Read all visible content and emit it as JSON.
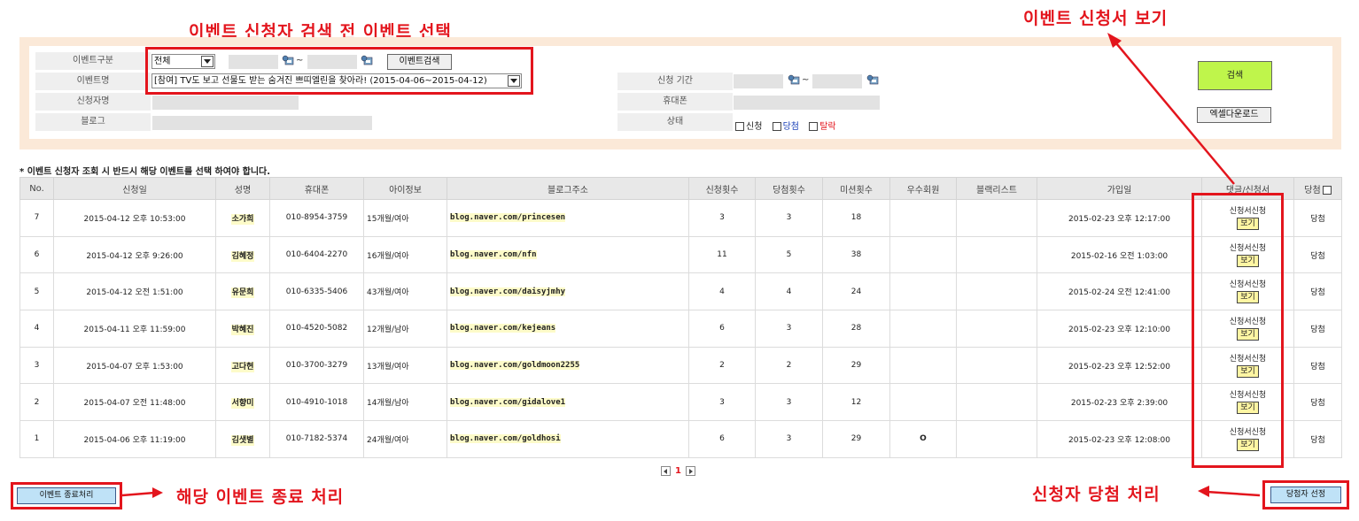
{
  "annotations": {
    "select_event": "이벤트 신청자 검색 전 이벤트 선택",
    "view_application": "이벤트 신청서 보기",
    "end_event": "해당 이벤트 종료 처리",
    "winner_process": "신청자 당첨 처리"
  },
  "search": {
    "event_type_label": "이벤트구분",
    "event_type_value": "전체",
    "event_search_button": "이벤트검색",
    "event_name_label": "이벤트명",
    "event_name_value": "[참여] TV도 보고 선물도 받는 숨겨진 쁘띠엘린을 찾아라! (2015-04-06~2015-04-12)",
    "applicant_label": "신청자명",
    "blog_label": "블로그",
    "period_label": "신청 기간",
    "phone_label": "휴대폰",
    "status_label": "상태",
    "status_options": [
      "신청",
      "당첨",
      "탈락"
    ],
    "tilde": "~",
    "search_button": "검색",
    "excel_button": "엑셀다운로드"
  },
  "notice": "* 이벤트 신청자 조회 시 반드시 해당 이벤트를 선택 하여야 합니다.",
  "table": {
    "headers": [
      "No.",
      "신청일",
      "성명",
      "휴대폰",
      "아이정보",
      "블로그주소",
      "신청횟수",
      "당첨횟수",
      "미션횟수",
      "우수회원",
      "블랙리스트",
      "가입일",
      "댓글/신청서",
      "당첨"
    ],
    "apply_label": "신청서신청",
    "view_label": "보기",
    "rows": [
      {
        "no": "7",
        "date": "2015-04-12 오후 10:53:00",
        "name": "소가희",
        "phone": "010-8954-3759",
        "child": "15개월/여아",
        "blog": "blog.naver.com/princesen",
        "apply": "3",
        "win": "3",
        "mission": "18",
        "vip": "",
        "black": "",
        "join": "2015-02-23 오후 12:17:00",
        "result": "당첨"
      },
      {
        "no": "6",
        "date": "2015-04-12 오후 9:26:00",
        "name": "김혜정",
        "phone": "010-6404-2270",
        "child": "16개월/여아",
        "blog": "blog.naver.com/nfn",
        "apply": "11",
        "win": "5",
        "mission": "38",
        "vip": "",
        "black": "",
        "join": "2015-02-16 오전 1:03:00",
        "result": "당첨"
      },
      {
        "no": "5",
        "date": "2015-04-12 오전 1:51:00",
        "name": "유문희",
        "phone": "010-6335-5406",
        "child": "43개월/여아",
        "blog": "blog.naver.com/daisyjmhy",
        "apply": "4",
        "win": "4",
        "mission": "24",
        "vip": "",
        "black": "",
        "join": "2015-02-24 오전 12:41:00",
        "result": "당첨"
      },
      {
        "no": "4",
        "date": "2015-04-11 오후 11:59:00",
        "name": "박혜진",
        "phone": "010-4520-5082",
        "child": "12개월/남아",
        "blog": "blog.naver.com/kejeans",
        "apply": "6",
        "win": "3",
        "mission": "28",
        "vip": "",
        "black": "",
        "join": "2015-02-23 오후 12:10:00",
        "result": "당첨"
      },
      {
        "no": "3",
        "date": "2015-04-07 오후 1:53:00",
        "name": "고다현",
        "phone": "010-3700-3279",
        "child": "13개월/여아",
        "blog": "blog.naver.com/goldmoon2255",
        "apply": "2",
        "win": "2",
        "mission": "29",
        "vip": "",
        "black": "",
        "join": "2015-02-23 오후 12:52:00",
        "result": "당첨"
      },
      {
        "no": "2",
        "date": "2015-04-07 오전 11:48:00",
        "name": "서향미",
        "phone": "010-4910-1018",
        "child": "14개월/남아",
        "blog": "blog.naver.com/gidalove1",
        "apply": "3",
        "win": "3",
        "mission": "12",
        "vip": "",
        "black": "",
        "join": "2015-02-23 오후 2:39:00",
        "result": "당첨"
      },
      {
        "no": "1",
        "date": "2015-04-06 오후 11:19:00",
        "name": "김샛별",
        "phone": "010-7182-5374",
        "child": "24개월/여아",
        "blog": "blog.naver.com/goldhosi",
        "apply": "6",
        "win": "3",
        "mission": "29",
        "vip": "O",
        "black": "",
        "join": "2015-02-23 오후 12:08:00",
        "result": "당첨"
      }
    ]
  },
  "pager": {
    "current": "1"
  },
  "footer": {
    "end_event_button": "이벤트 종료처리",
    "select_winner_button": "당첨자 선정"
  },
  "colors": {
    "annotation_red": "#e3151d",
    "panel_border": "#fbe9d8",
    "search_green": "#bff54b",
    "button_blue": "#bfe2f7",
    "name_green": "#2f7a00"
  }
}
